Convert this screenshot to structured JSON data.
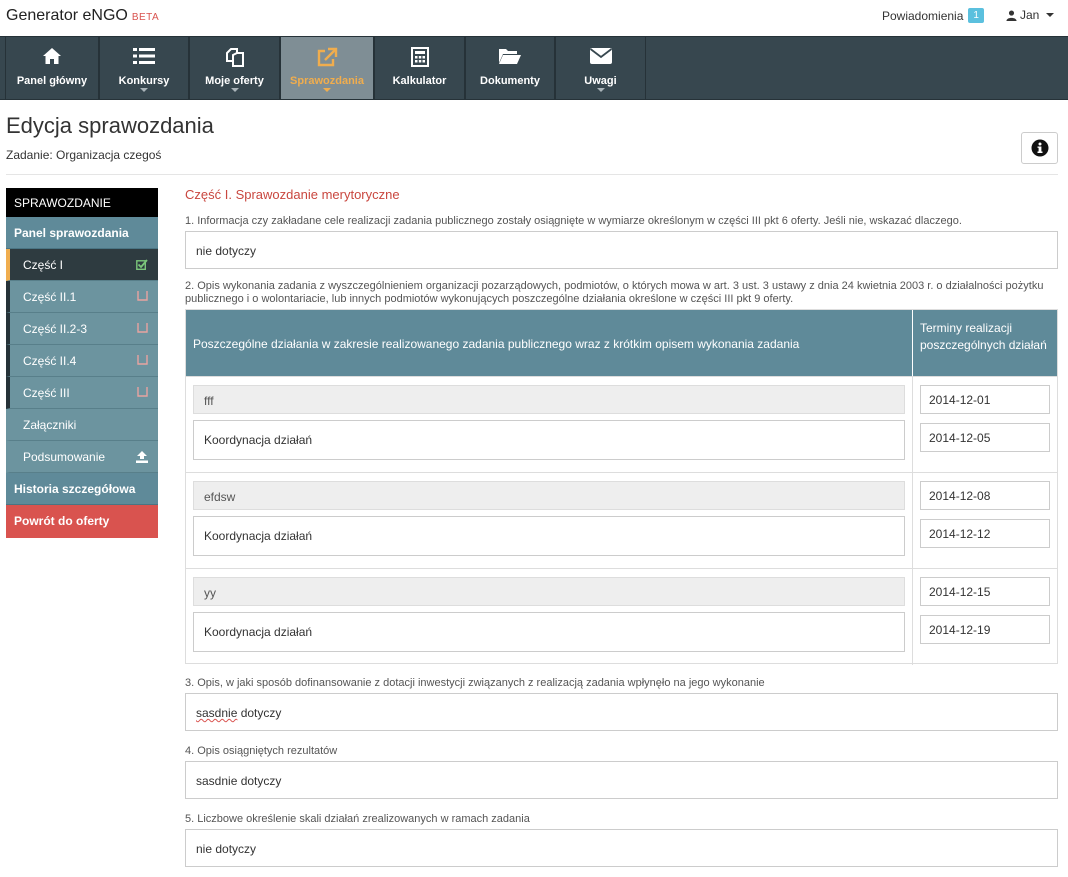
{
  "app": {
    "name": "Generator eNGO",
    "beta": "BETA"
  },
  "topbar": {
    "notifications_label": "Powiadomienia",
    "notifications_count": "1",
    "user_name": "Jan"
  },
  "nav": [
    {
      "label": "Panel główny",
      "icon": "home-icon"
    },
    {
      "label": "Konkursy",
      "icon": "list-icon"
    },
    {
      "label": "Moje oferty",
      "icon": "copy-icon"
    },
    {
      "label": "Sprawozdania",
      "icon": "external-link-icon"
    },
    {
      "label": "Kalkulator",
      "icon": "calculator-icon"
    },
    {
      "label": "Dokumenty",
      "icon": "folder-open-icon"
    },
    {
      "label": "Uwagi",
      "icon": "envelope-icon"
    }
  ],
  "page": {
    "title": "Edycja sprawozdania",
    "task_prefix": "Zadanie:",
    "task_name": "Organizacja czegoś"
  },
  "sidebar": {
    "header": "SPRAWOZDANIE",
    "panel": "Panel sprawozdania",
    "items": [
      {
        "label": "Część I"
      },
      {
        "label": "Część II.1"
      },
      {
        "label": "Część II.2-3"
      },
      {
        "label": "Część II.4"
      },
      {
        "label": "Część III"
      },
      {
        "label": "Załączniki"
      },
      {
        "label": "Podsumowanie"
      }
    ],
    "history": "Historia szczegółowa",
    "back": "Powrót do oferty"
  },
  "main": {
    "section_title": "Część I. Sprawozdanie merytoryczne",
    "q1": {
      "label": "1. Informacja czy zakładane cele realizacji zadania publicznego zostały osiągnięte w wymiarze określonym w części III pkt 6 oferty. Jeśli nie, wskazać dlaczego.",
      "value": "nie dotyczy"
    },
    "q2": {
      "label": "2. Opis wykonania zadania z wyszczególnieniem organizacji pozarządowych, podmiotów, o których mowa w art. 3 ust. 3 ustawy z dnia 24 kwietnia 2003 r. o działalności pożytku publicznego i o wolontariacie, lub innych podmiotów wykonujących poszczególne działania określone w części III pkt 9 oferty.",
      "col1": "Poszczególne działania w zakresie realizowanego zadania publicznego wraz z krótkim opisem wykonania zadania",
      "col2": "Terminy realizacji poszczególnych działań",
      "rows": [
        {
          "name": "fff",
          "description": "Koordynacja działań",
          "date_from": "2014-12-01",
          "date_to": "2014-12-05"
        },
        {
          "name": "efdsw",
          "description": "Koordynacja działań",
          "date_from": "2014-12-08",
          "date_to": "2014-12-12"
        },
        {
          "name": "yy",
          "description": "Koordynacja działań",
          "date_from": "2014-12-15",
          "date_to": "2014-12-19"
        }
      ]
    },
    "q3": {
      "label": "3. Opis, w jaki sposób dofinansowanie z dotacji inwestycji związanych z realizacją zadania wpłynęło na jego wykonanie",
      "value_word1": "sasdnie",
      "value_rest": " dotyczy"
    },
    "q4": {
      "label": "4. Opis osiągniętych rezultatów",
      "value": "sasdnie dotyczy"
    },
    "q5": {
      "label": "5. Liczbowe określenie skali działań zrealizowanych w ramach zadania",
      "value": "nie dotyczy"
    }
  },
  "colors": {
    "accent": "#5f8a99",
    "nav_bg": "#37474f",
    "danger": "#d9534f",
    "active_tab": "#f0ad4e",
    "badge": "#5bc0de"
  }
}
